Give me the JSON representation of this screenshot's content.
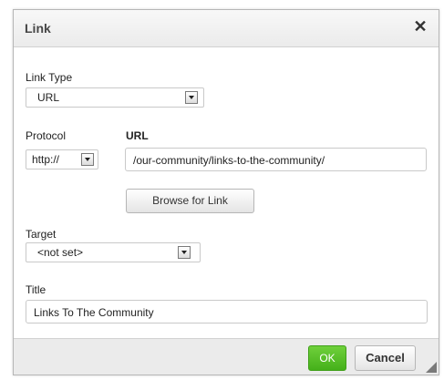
{
  "dialog": {
    "title": "Link",
    "close_glyph": "✕"
  },
  "link_type": {
    "label": "Link Type",
    "value": "URL"
  },
  "protocol": {
    "label": "Protocol",
    "value": "http://"
  },
  "url": {
    "label": "URL",
    "value": "/our-community/links-to-the-community/"
  },
  "browse_button": {
    "label": "Browse for Link"
  },
  "target": {
    "label": "Target",
    "value": "<not set>"
  },
  "title_field": {
    "label": "Title",
    "value": "Links To The Community"
  },
  "footer": {
    "ok_label": "OK",
    "cancel_label": "Cancel"
  },
  "colors": {
    "ok_green": "#56bf2a",
    "border": "#c9c9c9"
  },
  "icons": [
    "close-icon",
    "dropdown-arrow-icon",
    "resize-handle-icon"
  ]
}
